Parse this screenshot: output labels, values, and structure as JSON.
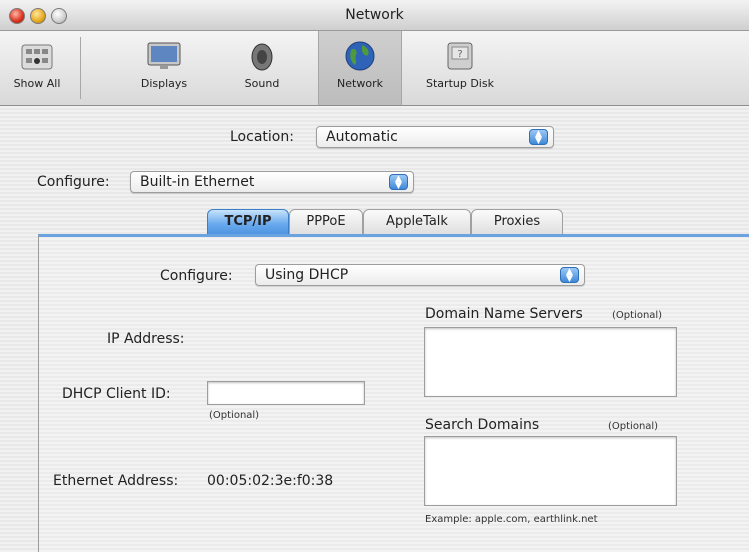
{
  "window": {
    "title": "Network"
  },
  "toolbar": {
    "items": [
      {
        "label": "Show All",
        "icon": "apple-grid-icon"
      },
      {
        "label": "Displays",
        "icon": "monitor-icon"
      },
      {
        "label": "Sound",
        "icon": "speaker-icon"
      },
      {
        "label": "Network",
        "icon": "globe-icon",
        "selected": true
      },
      {
        "label": "Startup Disk",
        "icon": "hard-disk-icon"
      }
    ]
  },
  "location": {
    "label": "Location:",
    "value": "Automatic"
  },
  "configure_interface": {
    "label": "Configure:",
    "value": "Built-in Ethernet"
  },
  "tabs": [
    "TCP/IP",
    "PPPoE",
    "AppleTalk",
    "Proxies"
  ],
  "tcpip": {
    "configure_label": "Configure:",
    "configure_value": "Using DHCP",
    "ip_address_label": "IP Address:",
    "dhcp_client_id_label": "DHCP Client ID:",
    "dhcp_client_id_value": "",
    "dhcp_optional": "(Optional)",
    "ethernet_address_label": "Ethernet Address:",
    "ethernet_address_value": "00:05:02:3e:f0:38",
    "dns_label": "Domain Name Servers",
    "dns_optional": "(Optional)",
    "search_domains_label": "Search Domains",
    "search_optional": "(Optional)",
    "example_text": "Example: apple.com, earthlink.net"
  },
  "colors": {
    "accent": "#4d93e0",
    "tab_active": "#6aaaee"
  }
}
